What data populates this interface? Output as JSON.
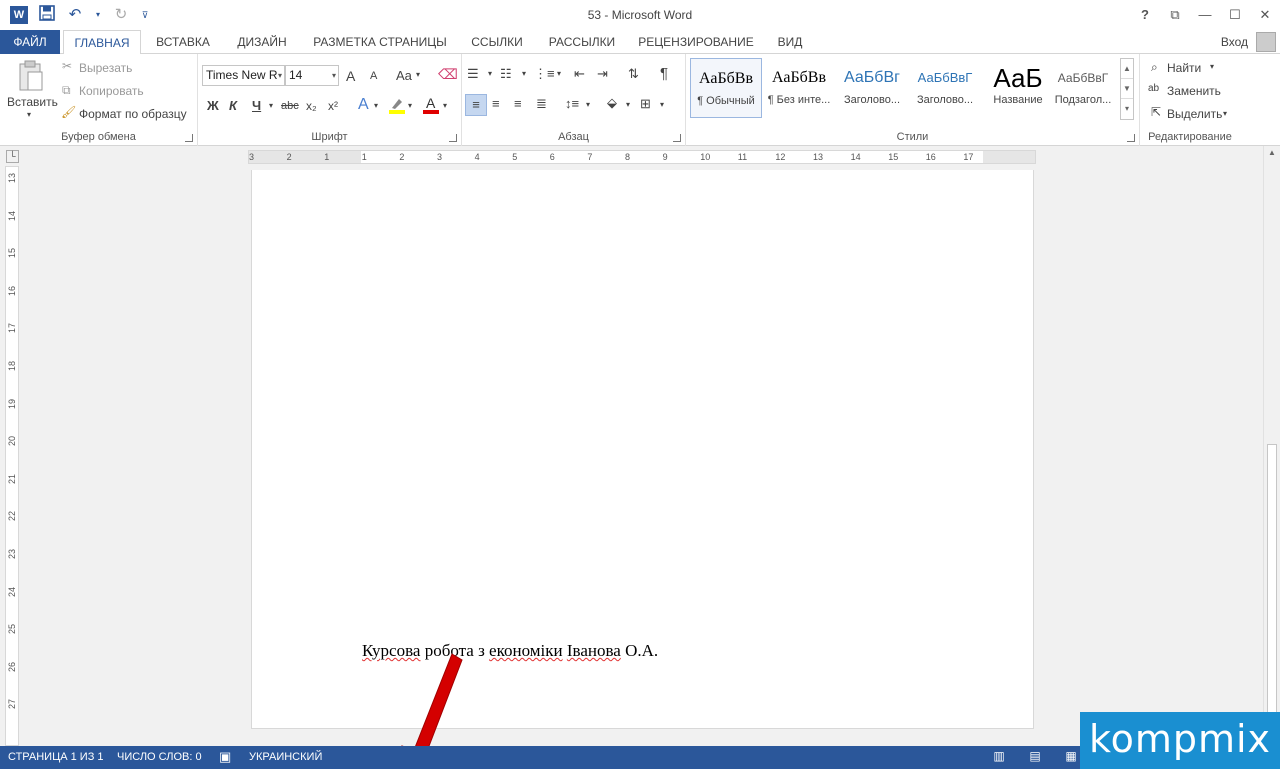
{
  "app": {
    "title": "53 - Microsoft Word",
    "icon_letter": "W"
  },
  "qat": {
    "icons": [
      "save-icon",
      "undo-icon",
      "redo-icon",
      "customize-icon"
    ]
  },
  "window": {
    "help": "?",
    "ribbon_display": "⧉",
    "minimize": "—",
    "maximize": "☐",
    "close": "✕"
  },
  "tabs": {
    "file": "ФАЙЛ",
    "items": [
      "ГЛАВНАЯ",
      "ВСТАВКА",
      "ДИЗАЙН",
      "РАЗМЕТКА СТРАНИЦЫ",
      "ССЫЛКИ",
      "РАССЫЛКИ",
      "РЕЦЕНЗИРОВАНИЕ",
      "ВИД"
    ],
    "signin": "Вход"
  },
  "ribbon": {
    "clipboard": {
      "paste": "Вставить",
      "cut": "Вырезать",
      "copy": "Копировать",
      "format_painter": "Формат по образцу",
      "label": "Буфер обмена"
    },
    "font": {
      "font_name": "Times New R",
      "font_size": "14",
      "bold": "Ж",
      "italic": "К",
      "underline": "Ч",
      "strike": "abc",
      "subscript": "x₂",
      "superscript": "x²",
      "grow": "A",
      "shrink": "A",
      "case": "Aa",
      "label": "Шрифт"
    },
    "paragraph": {
      "label": "Абзац"
    },
    "styles": {
      "items": [
        {
          "preview": "АаБбВв",
          "name": "¶ Обычный"
        },
        {
          "preview": "АаБбВв",
          "name": "¶ Без инте..."
        },
        {
          "preview": "АаБбВг",
          "name": "Заголово..."
        },
        {
          "preview": "АаБбВвГ",
          "name": "Заголово..."
        },
        {
          "preview": "АаБ",
          "name": "Название"
        },
        {
          "preview": "АаБбВвГ",
          "name": "Подзагол..."
        }
      ],
      "label": "Стили"
    },
    "editing": {
      "find": "Найти",
      "replace": "Заменить",
      "select": "Выделить",
      "label": "Редактирование"
    }
  },
  "ruler": {
    "h_ticks": [
      "3",
      "2",
      "1",
      "1",
      "2",
      "3",
      "4",
      "5",
      "6",
      "7",
      "8",
      "9",
      "10",
      "11",
      "12",
      "13",
      "14",
      "15",
      "16",
      "17"
    ],
    "v_ticks": [
      "13",
      "14",
      "15",
      "16",
      "17",
      "18",
      "19",
      "20",
      "21",
      "22",
      "23",
      "24",
      "25",
      "26",
      "27"
    ]
  },
  "document": {
    "word1": "Курсова",
    "text_middle": " робота з ",
    "word2": "економіки",
    "text_space": " ",
    "word3": "Іванова",
    "text_end": " О.А."
  },
  "status": {
    "page": "СТРАНИЦА 1 ИЗ 1",
    "words": "ЧИСЛО СЛОВ: 0",
    "language": "УКРАИНСКИЙ"
  },
  "watermark": "kompmix",
  "colors": {
    "brand": "#2b579a",
    "arrow": "#d40000",
    "watermark_bg": "#1a8fd1"
  }
}
